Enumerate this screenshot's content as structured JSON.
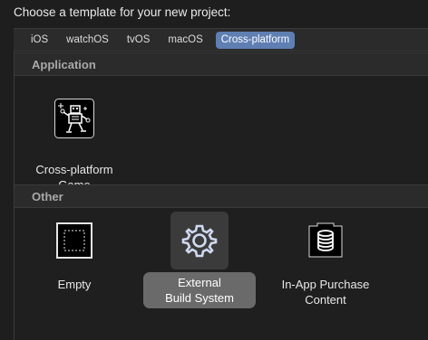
{
  "prompt": "Choose a template for your new project:",
  "tabs": [
    {
      "label": "iOS",
      "selected": false
    },
    {
      "label": "watchOS",
      "selected": false
    },
    {
      "label": "tvOS",
      "selected": false
    },
    {
      "label": "macOS",
      "selected": false
    },
    {
      "label": "Cross-platform",
      "selected": true
    }
  ],
  "sections": [
    {
      "title": "Application",
      "items": [
        {
          "label": "Cross-platform\nGame",
          "icon": "game-robot-icon",
          "selected": false
        }
      ]
    },
    {
      "title": "Other",
      "items": [
        {
          "label": "Empty",
          "icon": "empty-template-icon",
          "selected": false
        },
        {
          "label": "External\nBuild System",
          "icon": "gear-icon",
          "selected": true
        },
        {
          "label": "In-App Purchase\nContent",
          "icon": "coin-stack-icon",
          "selected": false
        }
      ]
    }
  ],
  "colors": {
    "accent": "#5f7fb3",
    "selection": "#6a6a6a",
    "background": "#1e1e1e",
    "header": "#2b2b2b"
  }
}
